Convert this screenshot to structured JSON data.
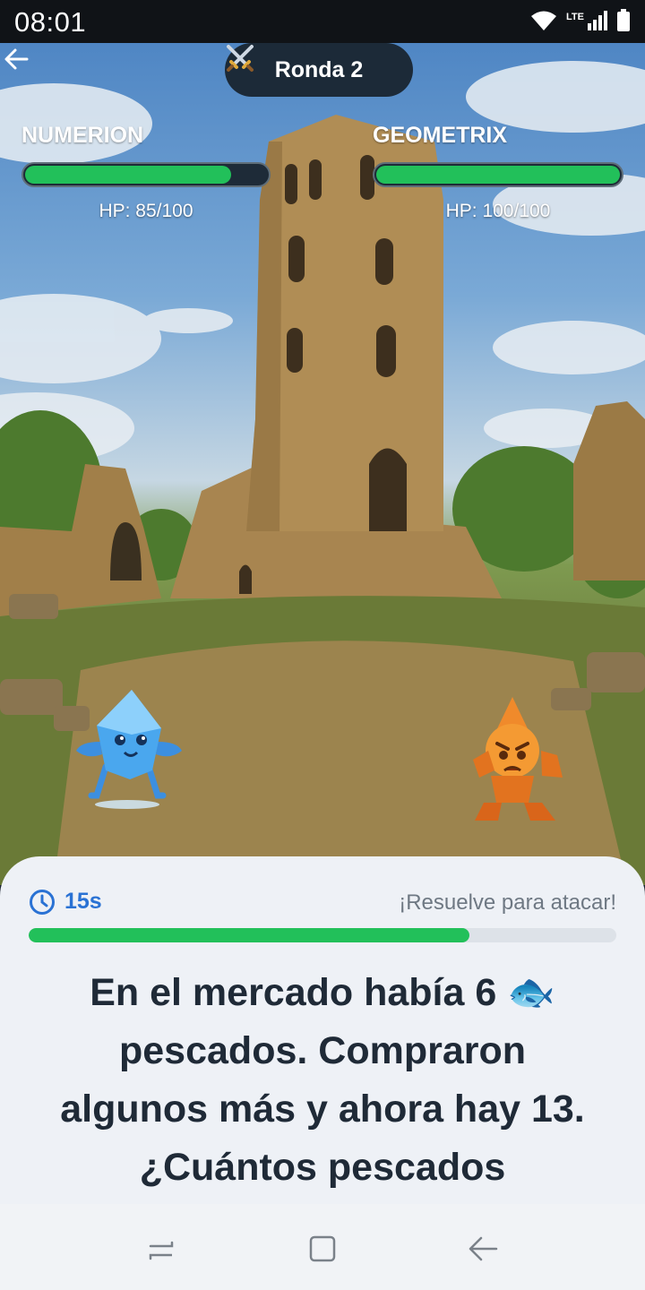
{
  "status_bar": {
    "time": "08:01",
    "network": "LTE"
  },
  "header": {
    "round_icon": "crossed-swords-icon",
    "round_label": "Ronda 2"
  },
  "player": {
    "name": "NUMERION",
    "hp_text": "HP: 85/100",
    "hp_fraction": 0.85
  },
  "enemy": {
    "name": "GEOMETRIX",
    "hp_text": "HP: 100/100",
    "hp_fraction": 1.0
  },
  "question_panel": {
    "timer": "15s",
    "hint": "¡Resuelve para atacar!",
    "time_remaining_fraction": 0.75,
    "question_lines": [
      "En el mercado había 6 🐟",
      "pescados. Compraron",
      "algunos más y ahora hay 13.",
      "¿Cuántos pescados"
    ]
  },
  "colors": {
    "accent": "#2a72d4",
    "health": "#22c05a",
    "pill": "#1c2a38"
  }
}
